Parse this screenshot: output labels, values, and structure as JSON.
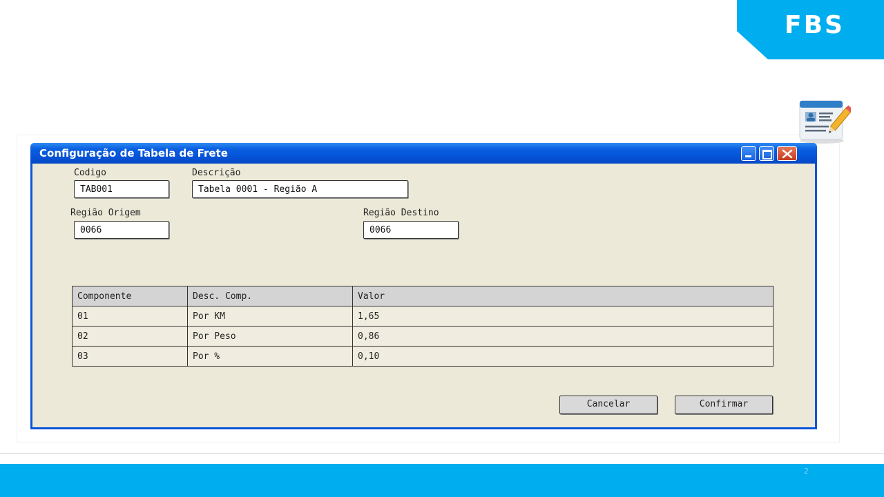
{
  "brand": {
    "name": "FBS",
    "accent": "#00adef"
  },
  "footer": {
    "page_number": "2"
  },
  "window": {
    "title": "Configuração de Tabela de Frete",
    "title_bar_color": "#0552d6",
    "body_color": "#ece9d8",
    "controls": [
      "minimize-icon",
      "maximize-icon",
      "close-icon"
    ]
  },
  "form": {
    "codigo": {
      "label": "Codigo",
      "value": "TAB001"
    },
    "descricao": {
      "label": "Descrição",
      "value": "Tabela 0001 - Região A"
    },
    "regiao_origem": {
      "label": "Região Origem",
      "value": "0066"
    },
    "regiao_destino": {
      "label": "Região Destino",
      "value": "0066"
    }
  },
  "table": {
    "columns": [
      "Componente",
      "Desc. Comp.",
      "Valor"
    ],
    "rows": [
      [
        "01",
        "Por KM",
        "1,65"
      ],
      [
        "02",
        "Por Peso",
        "0,86"
      ],
      [
        "03",
        "Por %",
        "0,10"
      ]
    ]
  },
  "actions": {
    "cancel": "Cancelar",
    "confirm": "Confirmar"
  },
  "icons": {
    "document": "document-edit-icon"
  }
}
